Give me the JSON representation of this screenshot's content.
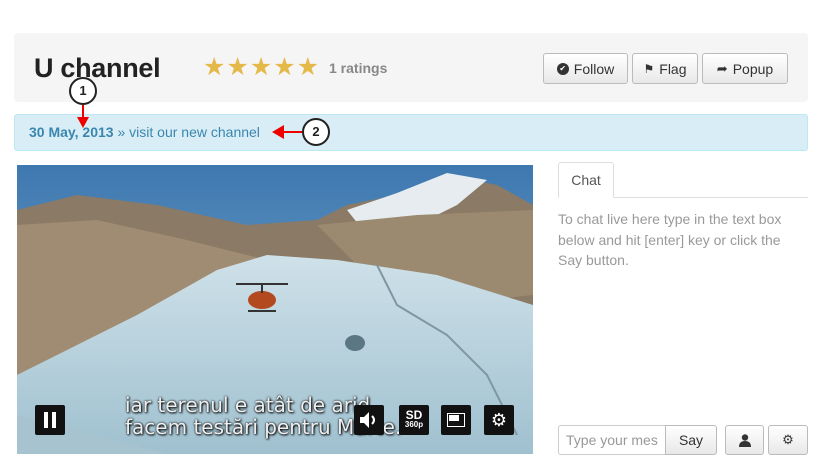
{
  "channel": {
    "title": "U channel",
    "stars": "★★★★★",
    "ratings_text": "1 ratings"
  },
  "actions": {
    "follow_label": "Follow",
    "flag_label": "Flag",
    "popup_label": "Popup"
  },
  "announcement": {
    "date": "30 May, 2013",
    "separator": " » ",
    "message": "visit our new channel"
  },
  "callouts": [
    "1",
    "2"
  ],
  "video": {
    "subtitle_line1": "iar terenul e atât de arid,",
    "subtitle_line2": "facem testări pentru Marte.",
    "quality": "SD",
    "resolution": "360p",
    "icons": [
      "pause-icon",
      "volume-icon",
      "quality-badge",
      "pip-icon",
      "gear-icon"
    ]
  },
  "chat": {
    "tab_label": "Chat",
    "help_text": "To chat live here type in the text box below and hit [enter] key or click the Say button.",
    "input_placeholder": "Type your message",
    "say_label": "Say",
    "icons": [
      "user-icon",
      "gear-icon"
    ]
  },
  "colors": {
    "star": "#e4b94a",
    "alert_bg": "#d9edf7",
    "alert_text": "#3a87ad",
    "annotation_arrow": "#ee0000"
  }
}
